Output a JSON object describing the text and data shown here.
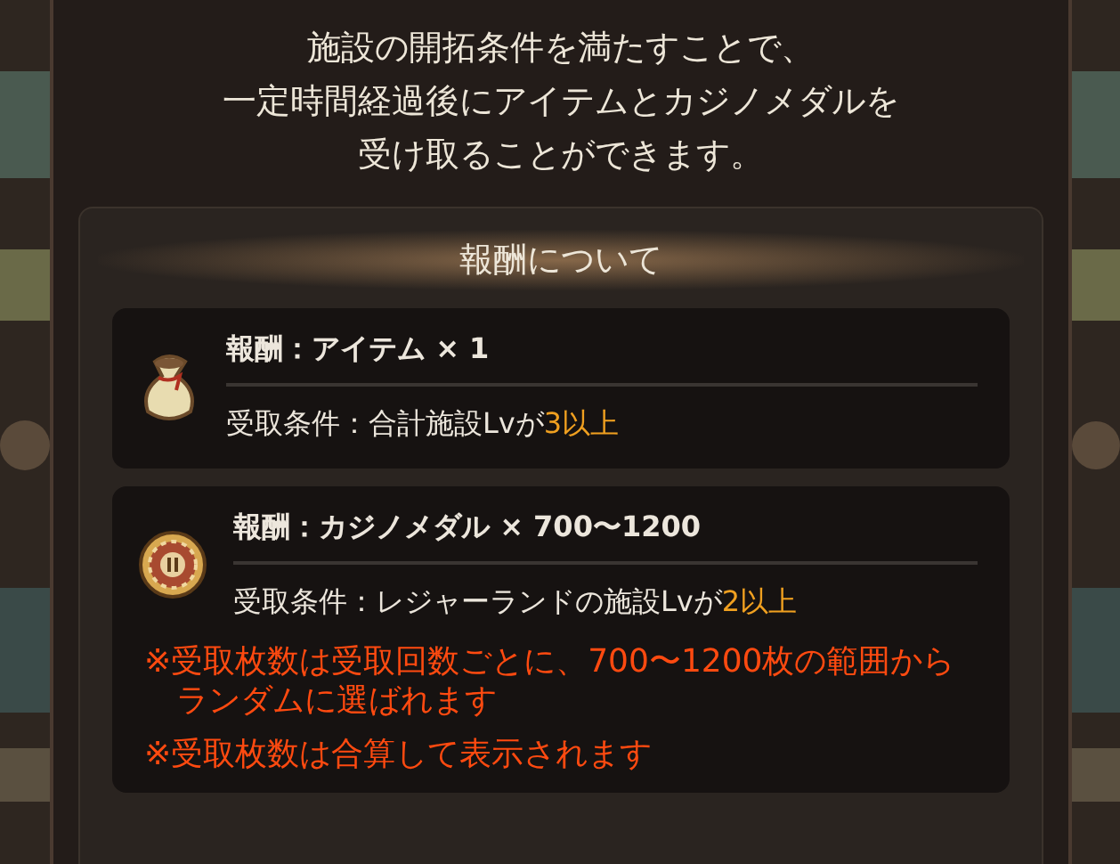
{
  "intro": [
    "施設の開拓条件を満たすことで、",
    "一定時間経過後にアイテムとカジノメダルを",
    "受け取ることができます。"
  ],
  "section": {
    "title": "報酬について",
    "rewards": [
      {
        "kind": "bag",
        "reward": "報酬：アイテム × 1",
        "condition": "受取条件：合計施設Lvが",
        "condition_value": "3以上"
      },
      {
        "kind": "medal",
        "reward": "報酬：カジノメダル × 700〜1200",
        "condition": "受取条件：レジャーランドの施設Lvが",
        "condition_value": "2以上",
        "notes": [
          "※受取枚数は受取回数ごとに、700〜1200枚の範囲からランダムに選ばれます",
          "※受取枚数は合算して表示されます"
        ]
      }
    ]
  }
}
